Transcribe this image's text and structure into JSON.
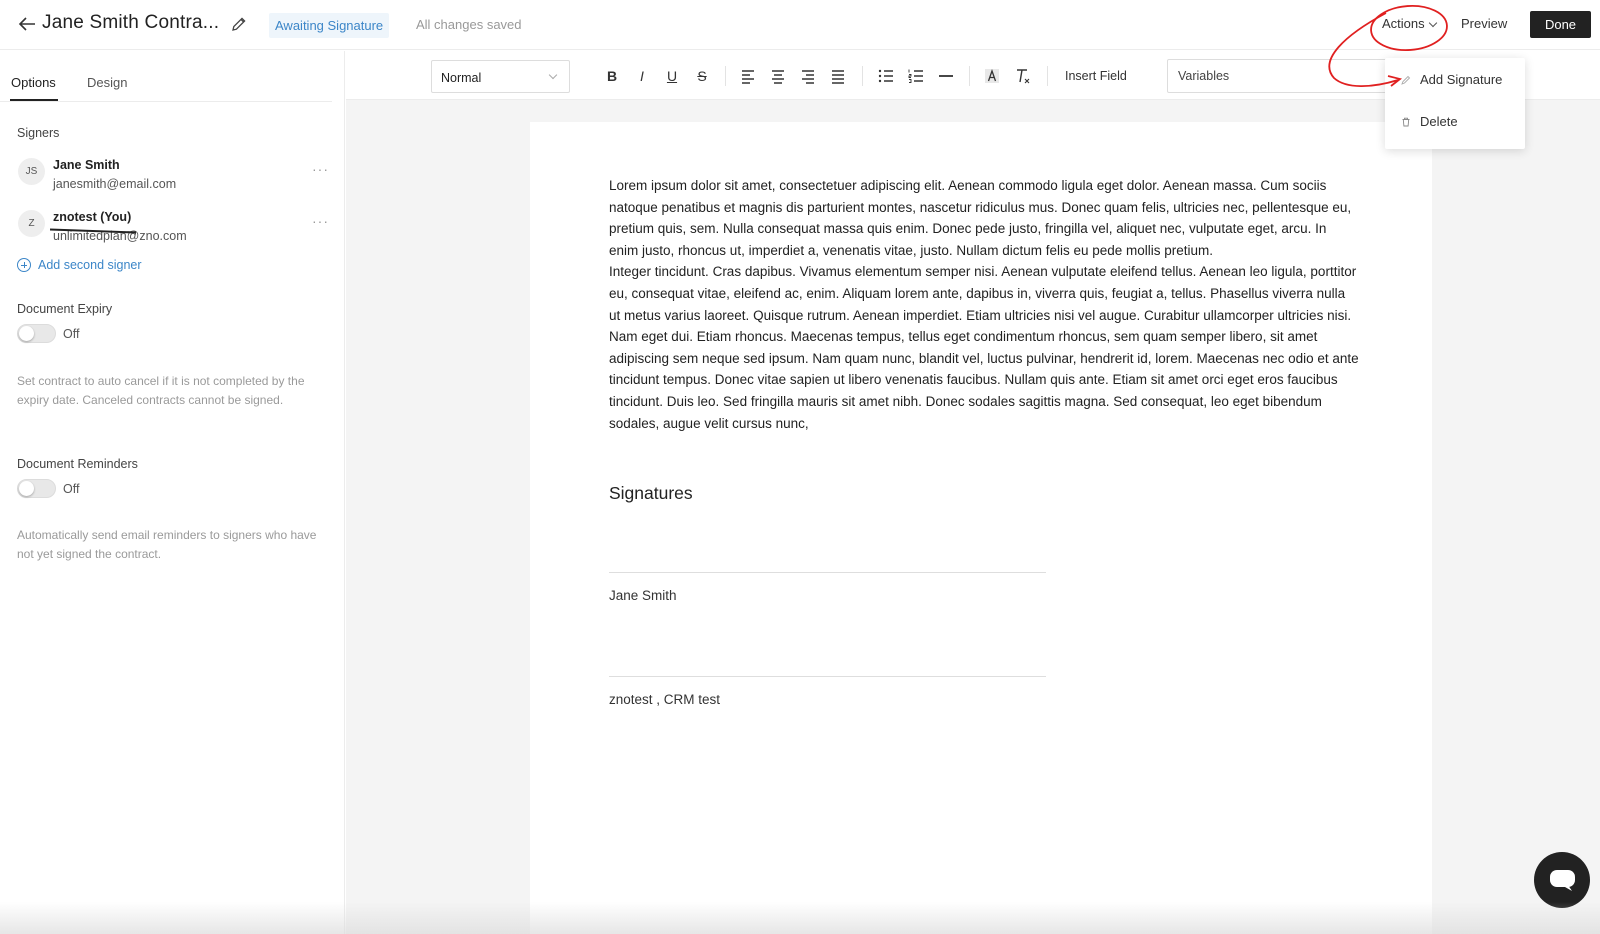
{
  "header": {
    "title": "Jane Smith Contra...",
    "status": "Awaiting Signature",
    "save_state": "All changes saved",
    "actions_label": "Actions",
    "preview_label": "Preview",
    "done_label": "Done"
  },
  "sidebar": {
    "tabs": [
      {
        "label": "Options",
        "active": true
      },
      {
        "label": "Design",
        "active": false
      }
    ],
    "signers_label": "Signers",
    "signers": [
      {
        "initials": "JS",
        "name": "Jane Smith",
        "email": "janesmith@email.com"
      },
      {
        "initials": "Z",
        "name": "znotest (You)",
        "email_struck": "unlimitedplan",
        "email_domain": "@zno.com"
      }
    ],
    "add_signer_label": "Add second signer",
    "expiry": {
      "label": "Document Expiry",
      "state": "Off",
      "help": "Set contract to auto cancel if it is not completed by the expiry date. Canceled contracts cannot be signed."
    },
    "reminders": {
      "label": "Document Reminders",
      "state": "Off",
      "help": "Automatically send email reminders to signers who have not yet signed the contract."
    }
  },
  "toolbar": {
    "style_value": "Normal",
    "insert_field_label": "Insert Field",
    "variables_label": "Variables",
    "buttons": [
      "B",
      "I",
      "U",
      "S"
    ]
  },
  "document": {
    "paragraph_1": "Lorem ipsum dolor sit amet, consectetuer adipiscing elit. Aenean commodo ligula eget dolor. Aenean massa. Cum sociis natoque penatibus et magnis dis parturient montes, nascetur ridiculus mus. Donec quam felis, ultricies nec, pellentesque eu, pretium quis, sem. Nulla consequat massa quis enim. Donec pede justo, fringilla vel, aliquet nec, vulputate eget, arcu. In enim justo, rhoncus ut, imperdiet a, venenatis vitae, justo. Nullam dictum felis eu pede mollis pretium.",
    "paragraph_2": "Integer tincidunt. Cras dapibus. Vivamus elementum semper nisi. Aenean vulputate eleifend tellus. Aenean leo ligula, porttitor eu, consequat vitae, eleifend ac, enim. Aliquam lorem ante, dapibus in, viverra quis, feugiat a, tellus. Phasellus viverra nulla ut metus varius laoreet. Quisque rutrum. Aenean imperdiet. Etiam ultricies nisi vel augue. Curabitur ullamcorper ultricies nisi. Nam eget dui. Etiam rhoncus. Maecenas tempus, tellus eget condimentum rhoncus, sem quam semper libero, sit amet adipiscing sem neque sed ipsum. Nam quam nunc, blandit vel, luctus pulvinar, hendrerit id, lorem. Maecenas nec odio et ante tincidunt tempus. Donec vitae sapien ut libero venenatis faucibus. Nullam quis ante. Etiam sit amet orci eget eros faucibus tincidunt. Duis leo. Sed fringilla mauris sit amet nibh. Donec sodales sagittis magna. Sed consequat, leo eget bibendum sodales, augue velit cursus nunc,",
    "signatures_heading": "Signatures",
    "signature_1": "Jane Smith",
    "signature_2": "znotest , CRM test"
  },
  "actions_menu": {
    "items": [
      {
        "label": "Add Signature",
        "icon": "pen-icon"
      },
      {
        "label": "Delete",
        "icon": "trash-icon"
      }
    ]
  },
  "colors": {
    "accent": "#3c86c8",
    "annotation": "#e02020",
    "done_bg": "#222222"
  }
}
